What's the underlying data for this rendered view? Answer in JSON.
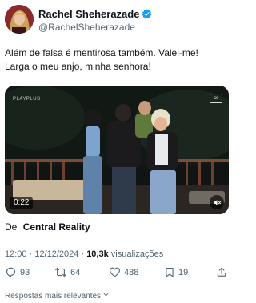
{
  "author": {
    "name": "Rachel Sheherazade",
    "handle": "@RachelSheherazade",
    "verified_color": "#1d9bf0"
  },
  "tweet": {
    "line1": "Além de falsa é mentirosa também. Valei-me!",
    "line2": "Larga o meu anjo, minha senhora!"
  },
  "media": {
    "duration": "0:22",
    "brand": "PLAYPLUS"
  },
  "source": {
    "prefix": "De",
    "name": "Central Reality"
  },
  "meta": {
    "time": "12:00",
    "separator": "·",
    "date": "12/12/2024",
    "views_count": "10,3k",
    "views_label": "visualizações"
  },
  "actions": {
    "replies": "93",
    "reposts": "64",
    "likes": "488",
    "bookmarks": "19"
  },
  "replies_sort": {
    "label": "Respostas mais relevantes"
  },
  "icons": [
    "verified-icon",
    "reply-icon",
    "repost-icon",
    "like-icon",
    "bookmark-icon",
    "share-icon",
    "mute-icon",
    "chevron-down-icon"
  ]
}
